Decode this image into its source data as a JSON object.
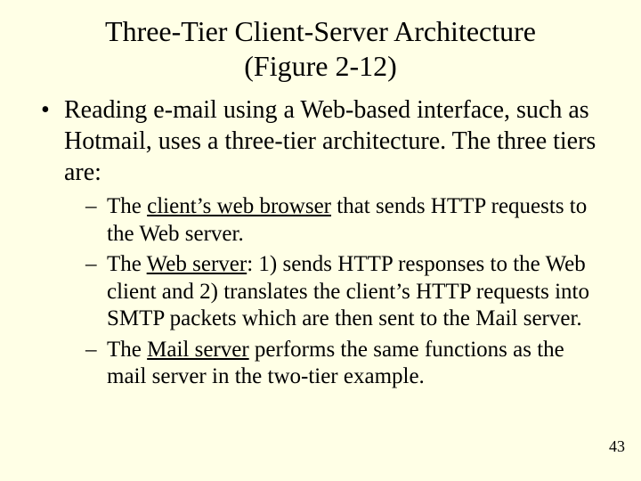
{
  "title_line1": "Three-Tier Client-Server Architecture",
  "title_line2": "(Figure 2-12)",
  "bullet1_pre": "Reading e-mail using a Web-based interface, such as Hotmail, uses a three-tier architecture. The three tiers are:",
  "sub1_pre": "The ",
  "sub1_u": "client’s web browser",
  "sub1_post": " that sends HTTP requests to the Web server.",
  "sub2_pre": "The ",
  "sub2_u": "Web server",
  "sub2_post": ": 1) sends HTTP responses to the Web client and 2) translates the client’s HTTP requests into SMTP packets which are then sent to the Mail server.",
  "sub3_pre": "The ",
  "sub3_u": "Mail server",
  "sub3_post": " performs the same functions as the mail server in the two-tier example.",
  "page_number": "43"
}
